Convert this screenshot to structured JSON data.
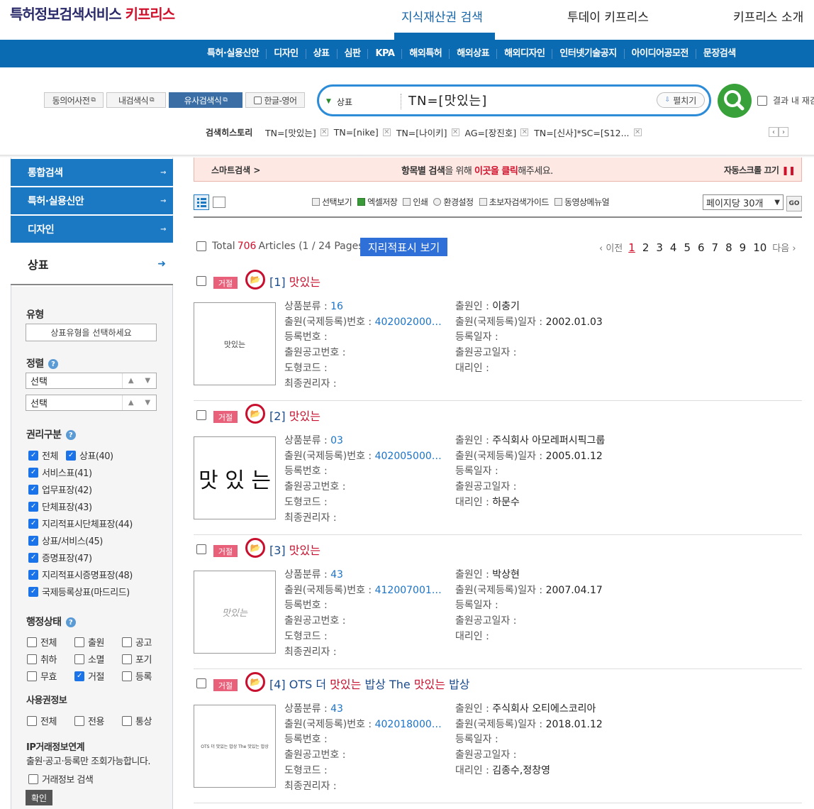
{
  "header": {
    "logo_main": "특허정보검색서비스",
    "logo_brand": "키프리스",
    "topnav": [
      "지식재산권 검색",
      "투데이 키프리스",
      "키프리스 소개"
    ],
    "menu": [
      "특허·실용신안",
      "디자인",
      "상표",
      "심판",
      "KPA",
      "해외특허",
      "해외상표",
      "해외디자인",
      "인터넷기술공지",
      "아이디어공모전",
      "문장검색"
    ]
  },
  "search": {
    "tools": [
      "동의어사전",
      "내검색식",
      "유사검색식",
      "한글-영어"
    ],
    "field": "상표",
    "query": "TN=[맛있는]",
    "expand_label": "펼치기",
    "within_label": "결과 내 재검",
    "history_label": "검색히스토리",
    "history": [
      "TN=[맛있는]",
      "TN=[nike]",
      "TN=[나이키]",
      "AG=[장진호]",
      "TN=[신사]*SC=[S12..."
    ]
  },
  "sidebar": {
    "tabs": [
      "통합검색",
      "특허·실용신안",
      "디자인"
    ],
    "active": "상표",
    "type_title": "유형",
    "type_select": "상표유형을 선택하세요",
    "sort_title": "정렬",
    "sort1": "선택",
    "sort2": "선택",
    "rights_title": "권리구분",
    "rights": [
      {
        "label": "전체",
        "checked": true
      },
      {
        "label": "상표(40)",
        "checked": true
      },
      {
        "label": "서비스표(41)",
        "checked": true
      },
      {
        "label": "업무표장(42)",
        "checked": true
      },
      {
        "label": "단체표장(43)",
        "checked": true
      },
      {
        "label": "지리적표시단체표장(44)",
        "checked": true
      },
      {
        "label": "상표/서비스(45)",
        "checked": true
      },
      {
        "label": "증명표장(47)",
        "checked": true
      },
      {
        "label": "지리적표시증명표장(48)",
        "checked": true
      },
      {
        "label": "국제등록상표(마드리드)",
        "checked": true
      }
    ],
    "status_title": "행정상태",
    "status": [
      {
        "label": "전체",
        "checked": false
      },
      {
        "label": "출원",
        "checked": false
      },
      {
        "label": "공고",
        "checked": false
      },
      {
        "label": "취하",
        "checked": false
      },
      {
        "label": "소멸",
        "checked": false
      },
      {
        "label": "포기",
        "checked": false
      },
      {
        "label": "무효",
        "checked": false
      },
      {
        "label": "거절",
        "checked": true
      },
      {
        "label": "등록",
        "checked": false
      }
    ],
    "usage_title": "사용권정보",
    "usage": [
      {
        "label": "전체",
        "checked": false
      },
      {
        "label": "전용",
        "checked": false
      },
      {
        "label": "통상",
        "checked": false
      }
    ],
    "ip_title": "IP거래정보연계",
    "ip_note": "출원·공고·등록만 조회가능합니다.",
    "ip_search": "거래정보 검색",
    "confirm": "확인"
  },
  "smartbar": {
    "label": "스마트검색 >",
    "msg_pre": "항목별 검색",
    "msg_mid": "을 위해 ",
    "msg_click": "이곳을 클릭",
    "msg_post": "해주세요.",
    "autoscroll": "자동스크롤 끄기",
    "pause": "❚❚"
  },
  "toolbar": {
    "items": [
      "선택보기",
      "엑셀저장",
      "인쇄",
      "환경설정",
      "초보자검색가이드",
      "동영상메뉴얼"
    ],
    "perpage": "페이지당 30개",
    "go": "GO"
  },
  "results_info": {
    "total_label": "Total",
    "total": "706",
    "articles": "Articles (1 / 24 Pages)",
    "geo_button": "지리적표시 보기",
    "prev": "이전",
    "next": "다음",
    "pages": [
      "1",
      "2",
      "3",
      "4",
      "5",
      "6",
      "7",
      "8",
      "9",
      "10"
    ]
  },
  "labels": {
    "badge": "거절",
    "class": "상품분류 : ",
    "appno": "출원(국제등록)번호 : ",
    "regno": "등록번호 : ",
    "pubno": "출원공고번호 : ",
    "shape": "도형코드 : ",
    "owner": "최종권리자 : ",
    "applicant": "출원인 : ",
    "appdate": "출원(국제등록)일자 : ",
    "regdate": "등록일자 : ",
    "pubdate": "출원공고일자 : ",
    "agent": "대리인 : "
  },
  "results": [
    {
      "num": "[1]",
      "pre": "",
      "hl": "맛있는",
      "post": "",
      "thumb": "맛있는",
      "class": "16",
      "appno": "4020020000...",
      "applicant": "이충기",
      "appdate": "2002.01.03",
      "agent": ""
    },
    {
      "num": "[2]",
      "pre": "",
      "hl": "맛있는",
      "post": "",
      "thumb": "맛 있 는",
      "class": "03",
      "appno": "4020050000...",
      "applicant": "주식회사 아모레퍼시픽그룹",
      "appdate": "2005.01.12",
      "agent": "하문수"
    },
    {
      "num": "[3]",
      "pre": "",
      "hl": "맛있는",
      "post": "",
      "thumb": "맛있는",
      "class": "43",
      "appno": "4120070010...",
      "applicant": "박상현",
      "appdate": "2007.04.17",
      "agent": ""
    },
    {
      "num": "[4]",
      "pre": "OTS 더 ",
      "hl": "맛있는",
      "post": " 밥상 The ",
      "hl2": "맛있는",
      "post2": " 밥상",
      "thumb": "OTS 더 맛있는 밥상 The 맛있는 밥상",
      "class": "43",
      "appno": "4020180000...",
      "applicant": "주식회사 오티에스코리아",
      "appdate": "2018.01.12",
      "agent": "김종수,정창영"
    }
  ]
}
